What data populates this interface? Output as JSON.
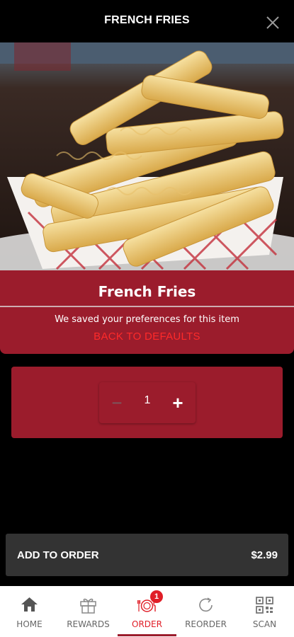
{
  "header": {
    "title": "FRENCH FRIES"
  },
  "item": {
    "name": "French Fries",
    "preferences_note": "We saved your preferences for this item",
    "reset_link": "BACK TO DEFAULTS"
  },
  "quantity": {
    "value": "1",
    "minus": "−",
    "plus": "+"
  },
  "add_to_order": {
    "label": "ADD TO ORDER",
    "price": "$2.99"
  },
  "tabs": [
    {
      "label": "HOME",
      "icon": "home-icon"
    },
    {
      "label": "REWARDS",
      "icon": "gift-icon"
    },
    {
      "label": "ORDER",
      "icon": "plate-icon",
      "badge": "1",
      "active": true
    },
    {
      "label": "REORDER",
      "icon": "reorder-icon"
    },
    {
      "label": "SCAN",
      "icon": "qr-icon"
    }
  ],
  "colors": {
    "brand": "#9b1c2c",
    "accent": "#e01e27"
  }
}
